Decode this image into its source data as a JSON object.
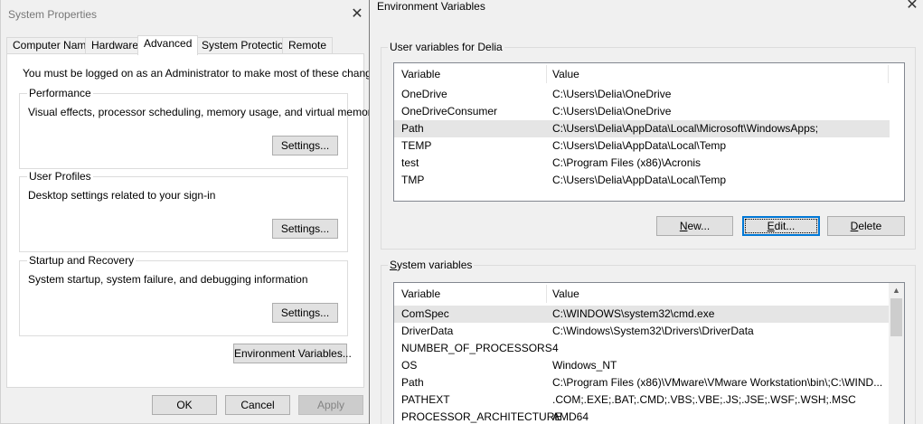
{
  "system_properties": {
    "title": "System Properties",
    "tabs": [
      {
        "label": "Computer Name"
      },
      {
        "label": "Hardware"
      },
      {
        "label": "Advanced"
      },
      {
        "label": "System Protection"
      },
      {
        "label": "Remote"
      }
    ],
    "active_tab": "Advanced",
    "admin_note": "You must be logged on as an Administrator to make most of these changes.",
    "groups": [
      {
        "label": "Performance",
        "description": "Visual effects, processor scheduling, memory usage, and virtual memory",
        "button": "Settings..."
      },
      {
        "label": "User Profiles",
        "description": "Desktop settings related to your sign-in",
        "button": "Settings..."
      },
      {
        "label": "Startup and Recovery",
        "description": "System startup, system failure, and debugging information",
        "button": "Settings..."
      }
    ],
    "env_button": "Environment Variables...",
    "footer": {
      "ok": "OK",
      "cancel": "Cancel",
      "apply": "Apply"
    }
  },
  "environment_variables": {
    "title": "Environment Variables",
    "user_section": {
      "label": "User variables for Delia",
      "columns": [
        "Variable",
        "Value"
      ],
      "rows": [
        {
          "variable": "OneDrive",
          "value": "C:\\Users\\Delia\\OneDrive"
        },
        {
          "variable": "OneDriveConsumer",
          "value": "C:\\Users\\Delia\\OneDrive"
        },
        {
          "variable": "Path",
          "value": "C:\\Users\\Delia\\AppData\\Local\\Microsoft\\WindowsApps;"
        },
        {
          "variable": "TEMP",
          "value": "C:\\Users\\Delia\\AppData\\Local\\Temp"
        },
        {
          "variable": "test",
          "value": "C:\\Program Files (x86)\\Acronis"
        },
        {
          "variable": "TMP",
          "value": "C:\\Users\\Delia\\AppData\\Local\\Temp"
        }
      ],
      "selected_row": "Path",
      "buttons": {
        "new": {
          "mnemonic": "N",
          "rest": "ew..."
        },
        "edit": {
          "mnemonic": "E",
          "rest": "dit..."
        },
        "delete": {
          "mnemonic": "D",
          "rest": "elete"
        }
      }
    },
    "system_section": {
      "label": "System variables",
      "label_mnemonic": "S",
      "label_rest": "ystem variables",
      "columns": [
        "Variable",
        "Value"
      ],
      "rows": [
        {
          "variable": "ComSpec",
          "value": "C:\\WINDOWS\\system32\\cmd.exe"
        },
        {
          "variable": "DriverData",
          "value": "C:\\Windows\\System32\\Drivers\\DriverData"
        },
        {
          "variable": "NUMBER_OF_PROCESSORS",
          "value": "4"
        },
        {
          "variable": "OS",
          "value": "Windows_NT"
        },
        {
          "variable": "Path",
          "value": "C:\\Program Files (x86)\\VMware\\VMware Workstation\\bin\\;C:\\WIND..."
        },
        {
          "variable": "PATHEXT",
          "value": ".COM;.EXE;.BAT;.CMD;.VBS;.VBE;.JS;.JSE;.WSF;.WSH;.MSC"
        },
        {
          "variable": "PROCESSOR_ARCHITECTURE",
          "value": "AMD64"
        }
      ],
      "selected_row": "ComSpec"
    }
  },
  "icons": {
    "close": "close-icon",
    "scroll_up": "chevron-up-icon",
    "scroll_down": "chevron-down-icon"
  }
}
